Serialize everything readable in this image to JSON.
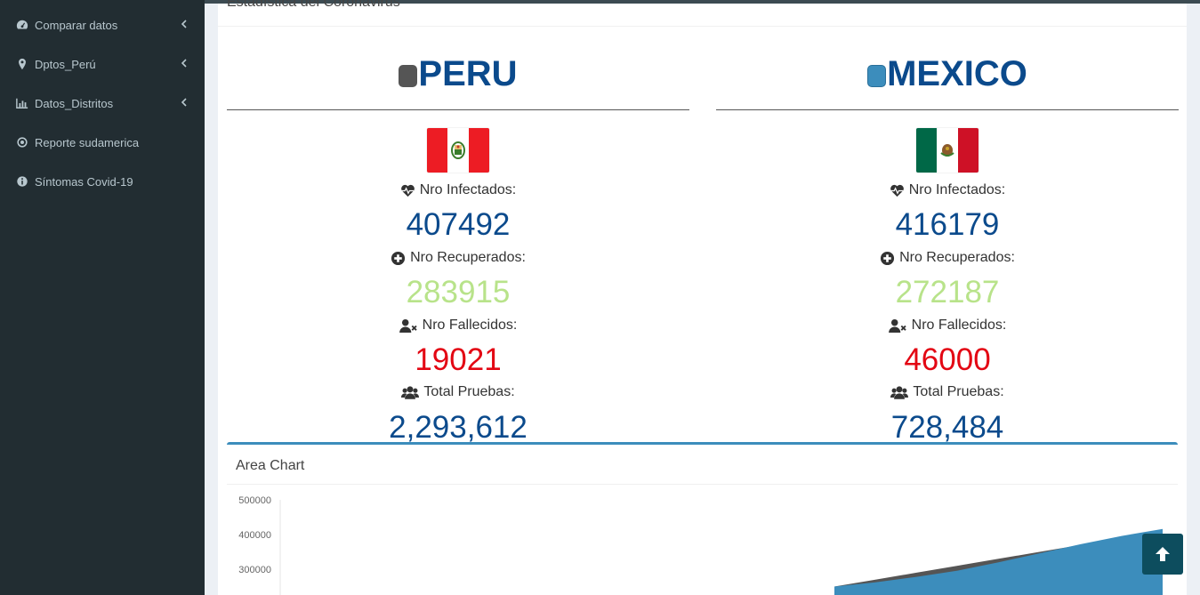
{
  "sidebar": {
    "items": [
      {
        "label": "Comparar datos",
        "icon": "dashboard-icon",
        "has_chevron": true
      },
      {
        "label": "Dptos_Perú",
        "icon": "map-marker-icon",
        "has_chevron": true
      },
      {
        "label": "Datos_Distritos",
        "icon": "bar-chart-icon",
        "has_chevron": true
      },
      {
        "label": "Reporte sudamerica",
        "icon": "dot-circle-icon",
        "has_chevron": false
      },
      {
        "label": "Síntomas Covid-19",
        "icon": "info-circle-icon",
        "has_chevron": false
      }
    ]
  },
  "box": {
    "title": "Estadística del Coronavirus"
  },
  "countries": [
    {
      "name": "PERU",
      "marker_color": "#555555",
      "flag": "peru-flag",
      "infectados_label": "Nro Infectados:",
      "infectados": "407492",
      "recuperados_label": "Nro Recuperados:",
      "recuperados": "283915",
      "fallecidos_label": "Nro Fallecidos:",
      "fallecidos": "19021",
      "pruebas_label": "Total Pruebas:",
      "pruebas": "2,293,612"
    },
    {
      "name": "MEXICO",
      "marker_color": "#3c8dbc",
      "flag": "mexico-flag",
      "infectados_label": "Nro Infectados:",
      "infectados": "416179",
      "recuperados_label": "Nro Recuperados:",
      "recuperados": "272187",
      "fallecidos_label": "Nro Fallecidos:",
      "fallecidos": "46000",
      "pruebas_label": "Total Pruebas:",
      "pruebas": "728,484"
    }
  ],
  "chart_section": {
    "title": "Area Chart"
  },
  "colors": {
    "sidebar_bg": "#222d32",
    "value_blue": "#0b4a8c",
    "value_green": "#b8e38a",
    "value_red": "#e30613",
    "area_peru": "#555555",
    "area_mexico": "#3c8dbc"
  },
  "chart_data": {
    "type": "area",
    "title": "",
    "xlabel": "",
    "ylabel": "",
    "y_ticks": [
      "500000",
      "400000",
      "300000"
    ],
    "ylim": [
      250000,
      500000
    ],
    "series": [
      {
        "name": "",
        "color": "#555555",
        "values": [
          250000,
          270000,
          290000,
          310000,
          330000,
          350000,
          370000,
          390000,
          407492
        ]
      },
      {
        "name": "",
        "color": "#3c8dbc",
        "values": [
          250000,
          262000,
          278000,
          296000,
          320000,
          346000,
          372000,
          396000,
          416179
        ]
      }
    ]
  },
  "scroll_top": {
    "icon": "arrow-up-icon"
  }
}
